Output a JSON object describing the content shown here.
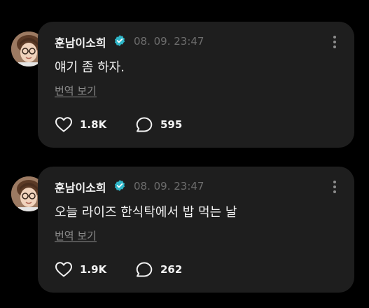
{
  "colors": {
    "background": "#000000",
    "card": "#1e1e1e",
    "verified": "#2fb6c8",
    "text": "#f3f3f3",
    "muted": "#6d6d6d"
  },
  "posts": [
    {
      "author": "훈남이소희",
      "verified": true,
      "timestamp": "08. 09. 23:47",
      "text": "얘기 좀 하자.",
      "translate_label": "번역 보기",
      "likes": "1.8K",
      "replies": "595",
      "icons": {
        "like": "heart-icon",
        "reply": "speech-bubble-icon",
        "more": "more-vertical-icon",
        "verified": "verified-badge-icon"
      }
    },
    {
      "author": "훈남이소희",
      "verified": true,
      "timestamp": "08. 09. 23:47",
      "text": "오늘 라이즈 한식탁에서 밥 먹는 날",
      "translate_label": "번역 보기",
      "likes": "1.9K",
      "replies": "262",
      "icons": {
        "like": "heart-icon",
        "reply": "speech-bubble-icon",
        "more": "more-vertical-icon",
        "verified": "verified-badge-icon"
      }
    }
  ]
}
